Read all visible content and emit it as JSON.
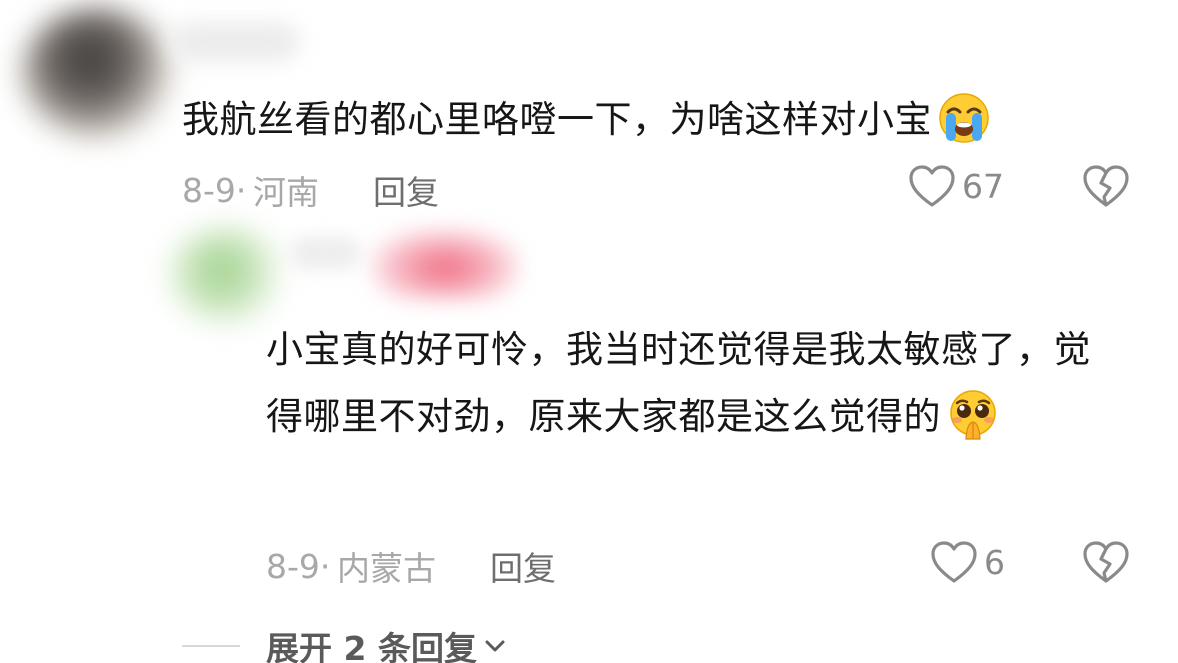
{
  "comments": [
    {
      "text": "我航丝看的都心里咯噔一下，为啥这样对小宝",
      "emoji": "loudly-crying-face-emoji",
      "date": "8-9",
      "location": "河南",
      "reply_label": "回复",
      "likes": "67"
    },
    {
      "text": "小宝真的好可怜，我当时还觉得是我太敏感了，觉得哪里不对劲，原来大家都是这么觉得的",
      "emoji": "pleading-face-emoji",
      "date": "8-9",
      "location": "内蒙古",
      "reply_label": "回复",
      "likes": "6"
    }
  ],
  "expand_replies": {
    "label": "展开 2 条回复"
  },
  "icons": {
    "like": "heart-outline-icon",
    "dislike": "broken-heart-icon",
    "expand": "chevron-down-icon"
  },
  "colors": {
    "text": "#161616",
    "meta": "#a8a8a8",
    "reply": "#6e6e6e",
    "icon": "#8a8a8a"
  }
}
